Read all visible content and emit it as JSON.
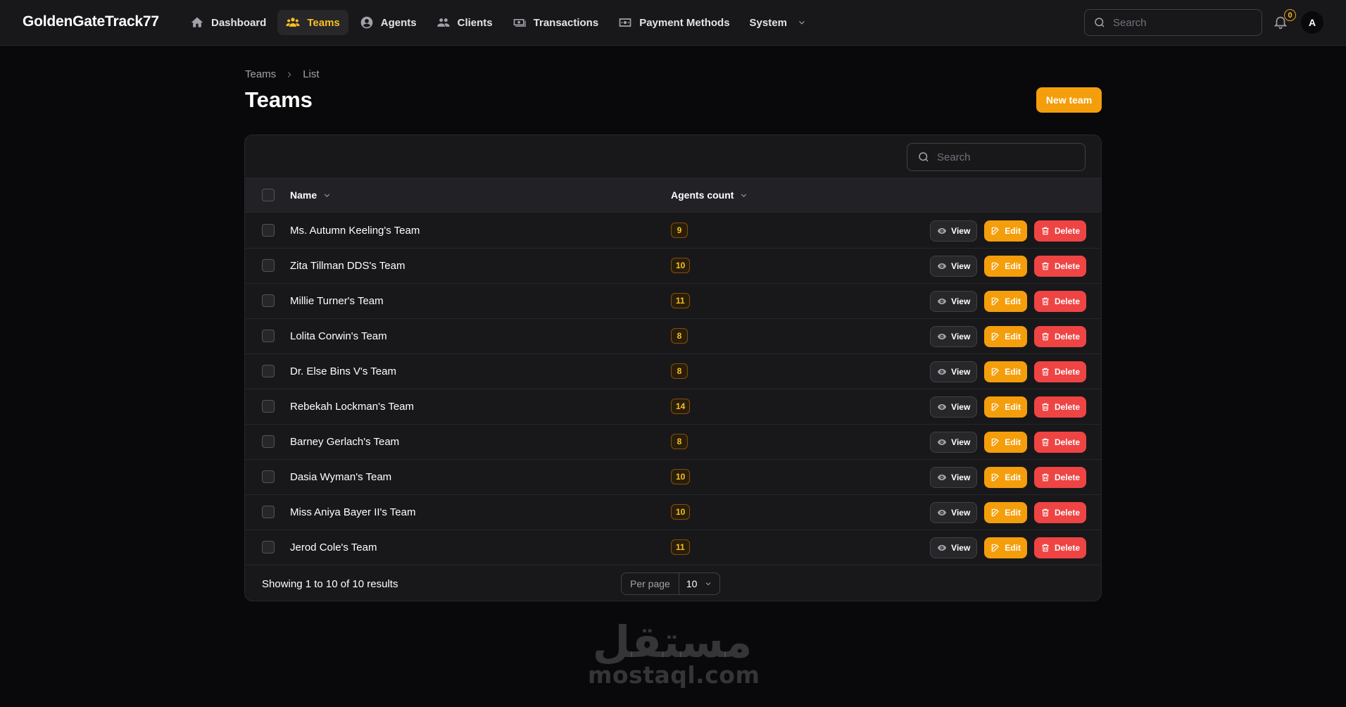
{
  "app": {
    "brand": "GoldenGateTrack77"
  },
  "nav": {
    "items": [
      {
        "label": "Dashboard",
        "icon": "home-icon",
        "active": false
      },
      {
        "label": "Teams",
        "icon": "users-group-icon",
        "active": true
      },
      {
        "label": "Agents",
        "icon": "user-circle-icon",
        "active": false
      },
      {
        "label": "Clients",
        "icon": "users-icon",
        "active": false
      },
      {
        "label": "Transactions",
        "icon": "banknotes-icon",
        "active": false
      },
      {
        "label": "Payment Methods",
        "icon": "money-icon",
        "active": false
      },
      {
        "label": "System",
        "icon": "chevron-down-icon",
        "active": false
      }
    ]
  },
  "topbar": {
    "search_placeholder": "Search",
    "notifications_count": "0",
    "avatar_initial": "A"
  },
  "page": {
    "breadcrumb": [
      "Teams",
      "List"
    ],
    "title": "Teams",
    "new_button": "New team"
  },
  "table": {
    "search_placeholder": "Search",
    "columns": {
      "name": "Name",
      "agents_count": "Agents count"
    },
    "actions": {
      "view": "View",
      "edit": "Edit",
      "delete": "Delete"
    },
    "rows": [
      {
        "name": "Ms. Autumn Keeling's Team",
        "agents_count": "9"
      },
      {
        "name": "Zita Tillman DDS's Team",
        "agents_count": "10"
      },
      {
        "name": "Millie Turner's Team",
        "agents_count": "11"
      },
      {
        "name": "Lolita Corwin's Team",
        "agents_count": "8"
      },
      {
        "name": "Dr. Else Bins V's Team",
        "agents_count": "8"
      },
      {
        "name": "Rebekah Lockman's Team",
        "agents_count": "14"
      },
      {
        "name": "Barney Gerlach's Team",
        "agents_count": "8"
      },
      {
        "name": "Dasia Wyman's Team",
        "agents_count": "10"
      },
      {
        "name": "Miss Aniya Bayer II's Team",
        "agents_count": "10"
      },
      {
        "name": "Jerod Cole's Team",
        "agents_count": "11"
      }
    ],
    "footer": {
      "results": "Showing 1 to 10 of 10 results",
      "per_page_label": "Per page",
      "per_page_value": "10"
    }
  },
  "watermark": {
    "arabic": "مستقل",
    "latin": "mostaql.com"
  },
  "colors": {
    "accent": "#f59e0b",
    "danger": "#ef4444",
    "background": "#09090b",
    "surface": "#18181b"
  }
}
